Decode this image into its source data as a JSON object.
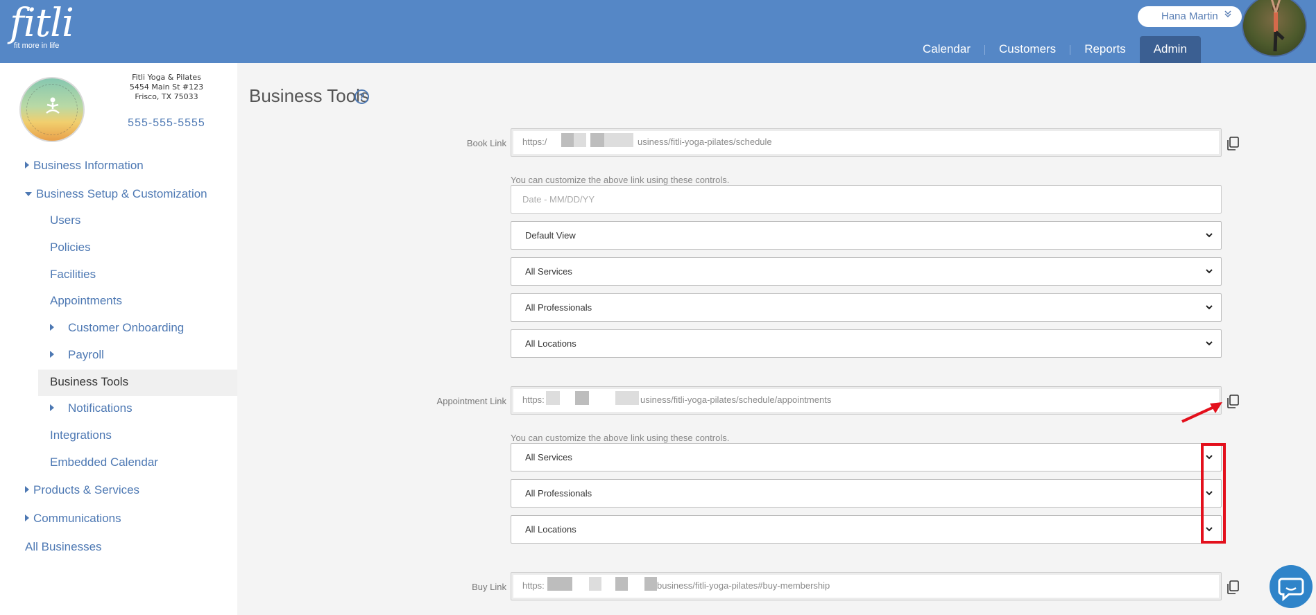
{
  "app": {
    "logo_word": "fitli",
    "logo_tag": "fit more in life"
  },
  "header": {
    "user_name": "Hana Martin",
    "nav": [
      {
        "label": "Calendar"
      },
      {
        "label": "Customers"
      },
      {
        "label": "Reports"
      },
      {
        "label": "Admin",
        "active": true
      }
    ]
  },
  "business": {
    "name": "Fitli Yoga & Pilates",
    "address1": "5454 Main St #123",
    "address2": "Frisco, TX 75033",
    "phone": "555-555-5555"
  },
  "sidebar": {
    "items": [
      {
        "label": "Business Information"
      },
      {
        "label": "Business Setup & Customization"
      },
      {
        "label": "Users"
      },
      {
        "label": "Policies"
      },
      {
        "label": "Facilities"
      },
      {
        "label": "Appointments"
      },
      {
        "label": "Customer Onboarding"
      },
      {
        "label": "Payroll"
      },
      {
        "label": "Business Tools"
      },
      {
        "label": "Notifications"
      },
      {
        "label": "Integrations"
      },
      {
        "label": "Embedded Calendar"
      },
      {
        "label": "Products & Services"
      },
      {
        "label": "Communications"
      },
      {
        "label": "All Businesses"
      }
    ]
  },
  "main": {
    "title": "Business Tools",
    "book_link": {
      "label": "Book Link",
      "prefix": "https:/",
      "suffix": "usiness/fitli-yoga-pilates/schedule"
    },
    "hint": "You can customize the above link using these controls.",
    "date_placeholder": "Date - MM/DD/YY",
    "book_selects": [
      "Default View",
      "All Services",
      "All Professionals",
      "All Locations"
    ],
    "appointment_link": {
      "label": "Appointment Link",
      "prefix": "https:",
      "suffix": "usiness/fitli-yoga-pilates/schedule/appointments"
    },
    "appointment_selects": [
      "All Services",
      "All Professionals",
      "All Locations"
    ],
    "buy_link": {
      "label": "Buy Link",
      "prefix": "https:",
      "suffix": "business/fitli-yoga-pilates#buy-membership"
    }
  },
  "colors": {
    "header_bg": "#5587c6",
    "nav_active_bg": "#3b5f92",
    "link_blue": "#4d78b3",
    "annotation_red": "#e3101c"
  }
}
